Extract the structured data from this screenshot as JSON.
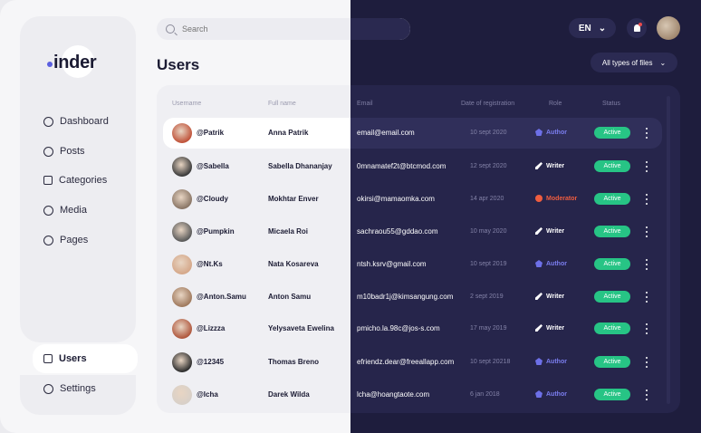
{
  "brand": {
    "name": "inder"
  },
  "search": {
    "placeholder": "Search"
  },
  "page_title": "Users",
  "header": {
    "language": "EN",
    "filter_label": "All types of files"
  },
  "sidebar": {
    "items": [
      {
        "label": "Dashboard",
        "icon": "clock-icon"
      },
      {
        "label": "Posts",
        "icon": "posts-icon"
      },
      {
        "label": "Categories",
        "icon": "grid-icon"
      },
      {
        "label": "Media",
        "icon": "media-icon"
      },
      {
        "label": "Pages",
        "icon": "pages-icon"
      }
    ],
    "users_label": "Users",
    "settings_label": "Settings"
  },
  "table": {
    "columns": [
      "Username",
      "Full name",
      "Email",
      "Date of registration",
      "Role",
      "Status"
    ],
    "rows": [
      {
        "username": "@Patrik",
        "full_name": "Anna Patrik",
        "email": "email@email.com",
        "date": "10 sept 2020",
        "role": "Author",
        "status": "Active",
        "avatar_color": "#c0533a"
      },
      {
        "username": "@Sabella",
        "full_name": "Sabella Dhananjay",
        "email": "0mnamatef2t@btcmod.com",
        "date": "12 sept 2020",
        "role": "Writer",
        "status": "Active",
        "avatar_color": "#3b3b3b"
      },
      {
        "username": "@Cloudy",
        "full_name": "Mokhtar Enver",
        "email": "okirsi@mamaomka.com",
        "date": "14 apr 2020",
        "role": "Moderator",
        "status": "Active",
        "avatar_color": "#8a7666"
      },
      {
        "username": "@Pumpkin",
        "full_name": "Micaela Roi",
        "email": "sachraou55@gddao.com",
        "date": "10 may 2020",
        "role": "Writer",
        "status": "Active",
        "avatar_color": "#5a5a5a"
      },
      {
        "username": "@Nt.Ks",
        "full_name": "Nata Kosareva",
        "email": "ntsh.ksrv@gmail.com",
        "date": "10 sept 2019",
        "role": "Author",
        "status": "Active",
        "avatar_color": "#d5a88a"
      },
      {
        "username": "@Anton.Samu",
        "full_name": "Anton Samu",
        "email": "m10badr1j@kimsangung.com",
        "date": "2 sept 2019",
        "role": "Writer",
        "status": "Active",
        "avatar_color": "#a07a5e"
      },
      {
        "username": "@Lizzza",
        "full_name": "Yelysaveta Ewelina",
        "email": "pmicho.la.98c@jos-s.com",
        "date": "17 may 2019",
        "role": "Writer",
        "status": "Active",
        "avatar_color": "#b0583e"
      },
      {
        "username": "@12345",
        "full_name": "Thomas Breno",
        "email": "efriendz.dear@freeallapp.com",
        "date": "10 sept 20218",
        "role": "Author",
        "status": "Active",
        "avatar_color": "#2e2e2e"
      },
      {
        "username": "@Icha",
        "full_name": "Darek Wilda",
        "email": "lcha@hoangtaote.com",
        "date": "6 jan 2018",
        "role": "Author",
        "status": "Active",
        "avatar_color": "#d8d0c8"
      }
    ]
  }
}
